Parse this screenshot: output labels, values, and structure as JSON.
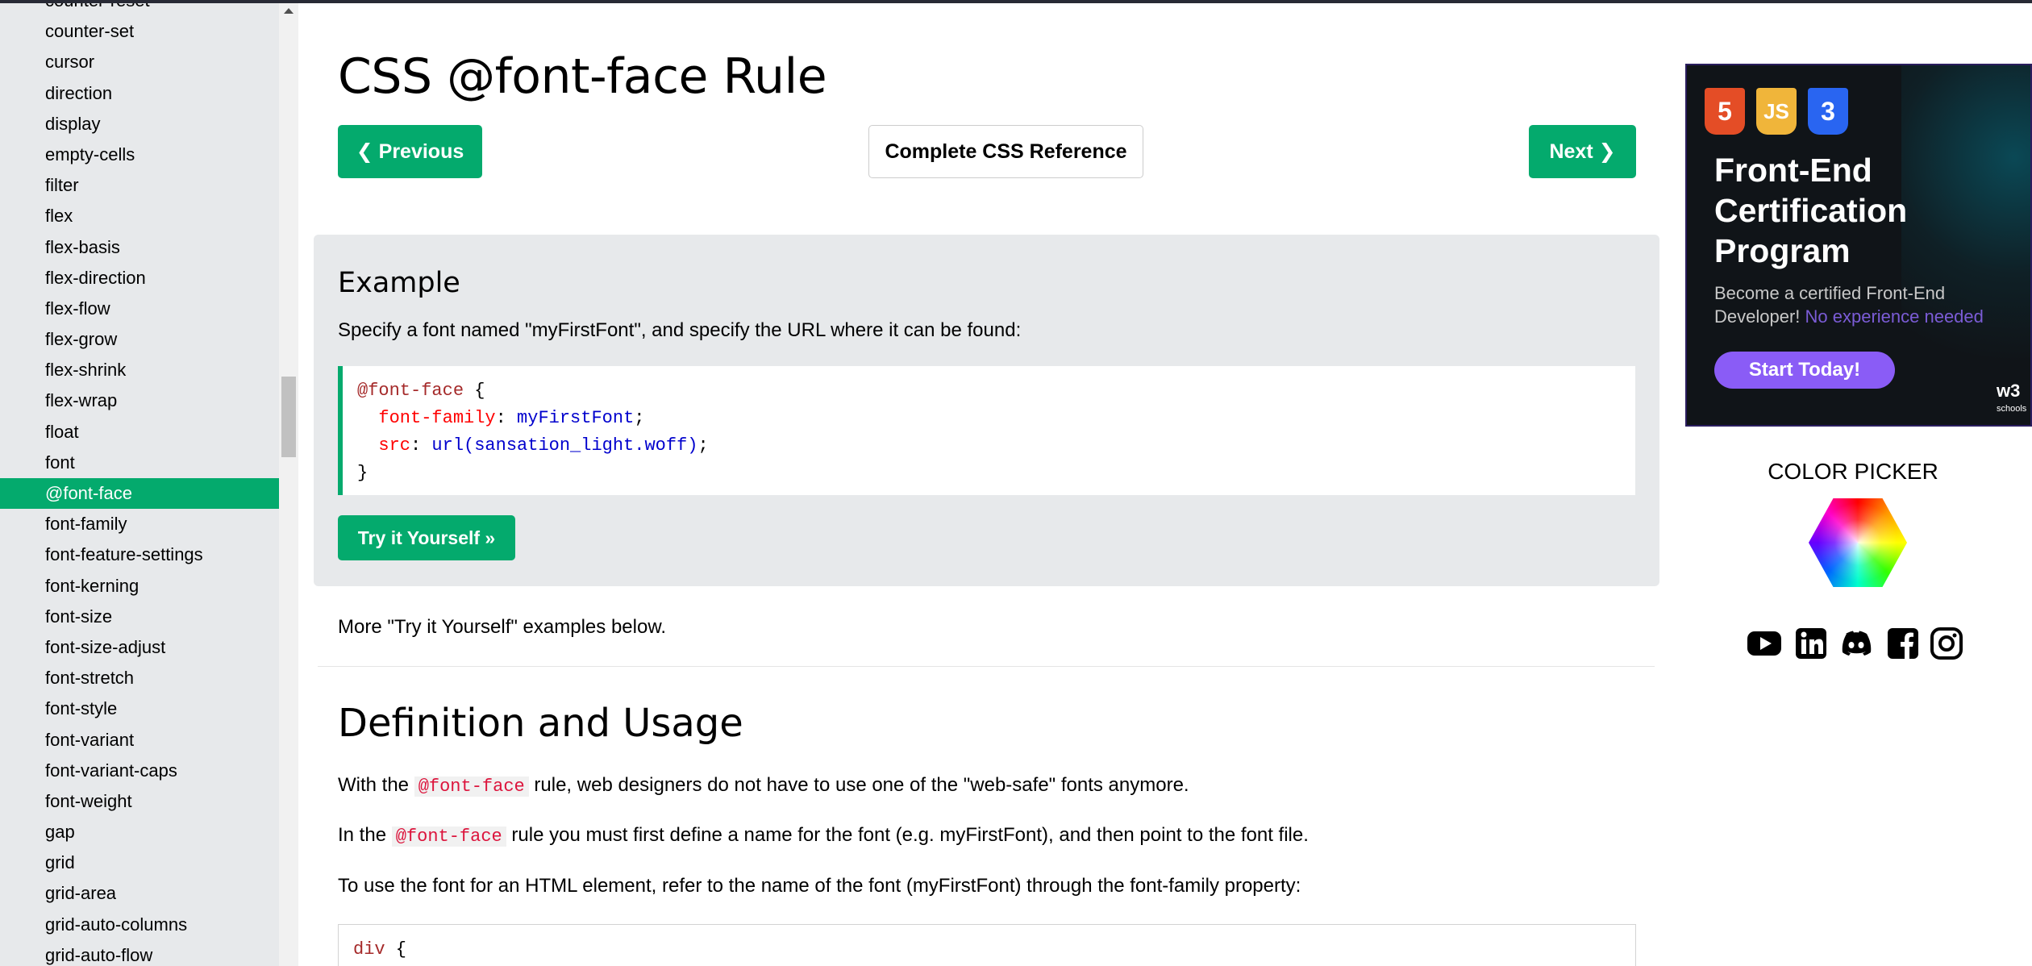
{
  "sidebar": {
    "items": [
      {
        "label": "counter-reset",
        "active": false
      },
      {
        "label": "counter-set",
        "active": false
      },
      {
        "label": "cursor",
        "active": false
      },
      {
        "label": "direction",
        "active": false
      },
      {
        "label": "display",
        "active": false
      },
      {
        "label": "empty-cells",
        "active": false
      },
      {
        "label": "filter",
        "active": false
      },
      {
        "label": "flex",
        "active": false
      },
      {
        "label": "flex-basis",
        "active": false
      },
      {
        "label": "flex-direction",
        "active": false
      },
      {
        "label": "flex-flow",
        "active": false
      },
      {
        "label": "flex-grow",
        "active": false
      },
      {
        "label": "flex-shrink",
        "active": false
      },
      {
        "label": "flex-wrap",
        "active": false
      },
      {
        "label": "float",
        "active": false
      },
      {
        "label": "font",
        "active": false
      },
      {
        "label": "@font-face",
        "active": true
      },
      {
        "label": "font-family",
        "active": false
      },
      {
        "label": "font-feature-settings",
        "active": false
      },
      {
        "label": "font-kerning",
        "active": false
      },
      {
        "label": "font-size",
        "active": false
      },
      {
        "label": "font-size-adjust",
        "active": false
      },
      {
        "label": "font-stretch",
        "active": false
      },
      {
        "label": "font-style",
        "active": false
      },
      {
        "label": "font-variant",
        "active": false
      },
      {
        "label": "font-variant-caps",
        "active": false
      },
      {
        "label": "font-weight",
        "active": false
      },
      {
        "label": "gap",
        "active": false
      },
      {
        "label": "grid",
        "active": false
      },
      {
        "label": "grid-area",
        "active": false
      },
      {
        "label": "grid-auto-columns",
        "active": false
      },
      {
        "label": "grid-auto-flow",
        "active": false
      }
    ]
  },
  "main": {
    "title": "CSS @font-face Rule",
    "prev_label": "❮ Previous",
    "reference_label": "Complete CSS Reference",
    "next_label": "Next ❯",
    "example": {
      "heading": "Example",
      "description": "Specify a font named \"myFirstFont\", and specify the URL where it can be found:",
      "code": {
        "line1_selector": "@font-face",
        "line1_brace": " {",
        "line2_prop": "font-family",
        "line2_colon": ":",
        "line2_value": " myFirstFont",
        "line2_end": ";",
        "line3_prop": "src",
        "line3_colon": ":",
        "line3_value": " url(sansation_light.woff)",
        "line3_end": ";",
        "line4": "}"
      },
      "try_label": "Try it Yourself »"
    },
    "more_text": "More \"Try it Yourself\" examples below.",
    "definition": {
      "heading": "Definition and Usage",
      "p1_before": "With the ",
      "p1_code": "@font-face",
      "p1_after": " rule, web designers do not have to use one of the \"web-safe\" fonts anymore.",
      "p2_before": "In the ",
      "p2_code": "@font-face",
      "p2_after": " rule you must first define a name for the font (e.g. myFirstFont), and then point to the font file.",
      "p3": "To use the font for an HTML element, refer to the name of the font (myFirstFont) through the font-family property:",
      "code2_selector": "div",
      "code2_brace": " {"
    }
  },
  "ad": {
    "badge_html": "5",
    "badge_js": "JS",
    "badge_css": "3",
    "title": "Front-End Certification Program",
    "subtitle": "Become a certified Front-End Developer!",
    "subtitle_highlight": " No experience needed",
    "button": "Start Today!",
    "brand": "w3",
    "brand_small": "schools"
  },
  "color_picker": {
    "title": "COLOR PICKER"
  },
  "social": [
    "youtube-icon",
    "linkedin-icon",
    "discord-icon",
    "facebook-icon",
    "instagram-icon"
  ],
  "colors": {
    "accent": "#04aa6d",
    "sidebar_bg": "#e7e9eb",
    "code_selector": "#a52a2a",
    "code_property": "#ff0000",
    "code_value": "#0000cd",
    "inline_code": "#dc143c",
    "ad_button": "#8a5cf6"
  }
}
